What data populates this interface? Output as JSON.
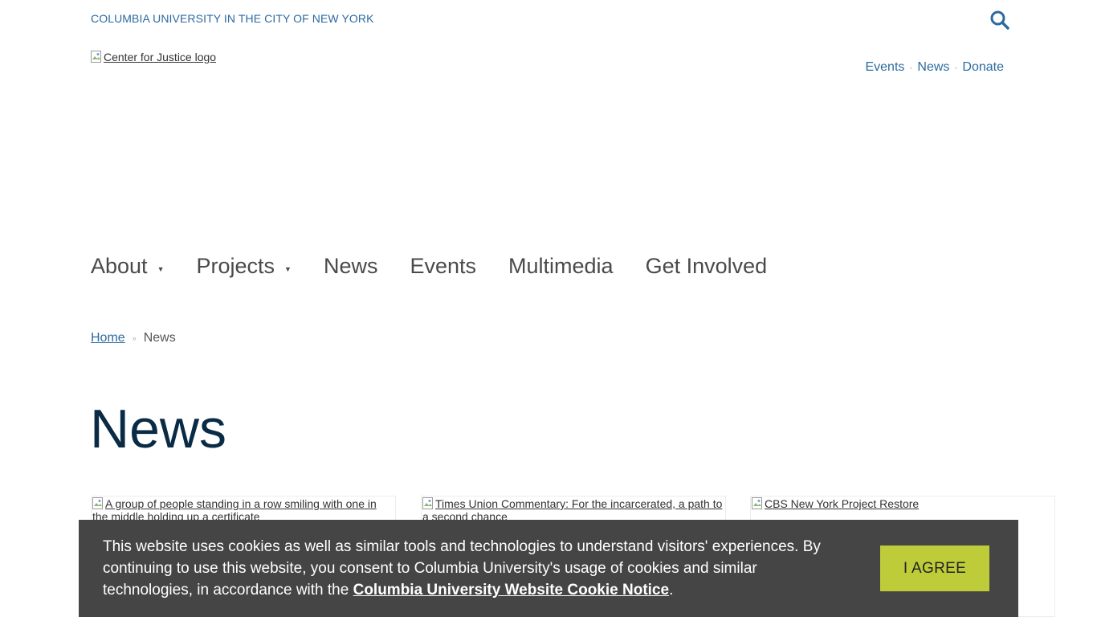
{
  "header": {
    "university_link": "COLUMBIA UNIVERSITY IN THE CITY OF NEW YORK",
    "logo_alt": "Center for Justice logo",
    "search_icon": "search-icon",
    "accent_color": "#2c6aa0"
  },
  "utility_nav": {
    "items": [
      "Events",
      "News",
      "Donate"
    ],
    "separator": "·"
  },
  "main_nav": {
    "items": [
      {
        "label": "About",
        "has_dropdown": true
      },
      {
        "label": "Projects",
        "has_dropdown": true
      },
      {
        "label": "News",
        "has_dropdown": false
      },
      {
        "label": "Events",
        "has_dropdown": false
      },
      {
        "label": "Multimedia",
        "has_dropdown": false
      },
      {
        "label": "Get Involved",
        "has_dropdown": false
      }
    ],
    "dropdown_glyph": "▼"
  },
  "breadcrumb": {
    "home": "Home",
    "separator": "»",
    "current": "News"
  },
  "page": {
    "title": "News",
    "title_color": "#0a2b45"
  },
  "cards": [
    {
      "image_alt": "A group of people standing in a row smiling with one in the middle holding up a certificate"
    },
    {
      "image_alt": "Times Union Commentary: For the incarcerated, a path to a second chance"
    },
    {
      "image_alt": "CBS New York Project Restore"
    }
  ],
  "cookie_banner": {
    "text_before": "This website uses cookies as well as similar tools and technologies to understand visitors' experiences. By continuing to use this website, you consent to Columbia University's usage of cookies and similar technologies, in accordance with the ",
    "link_text": "Columbia University Website Cookie Notice",
    "text_after": ".",
    "button_label": "I AGREE",
    "background_color": "#454545",
    "button_color": "#bfcc3a"
  }
}
